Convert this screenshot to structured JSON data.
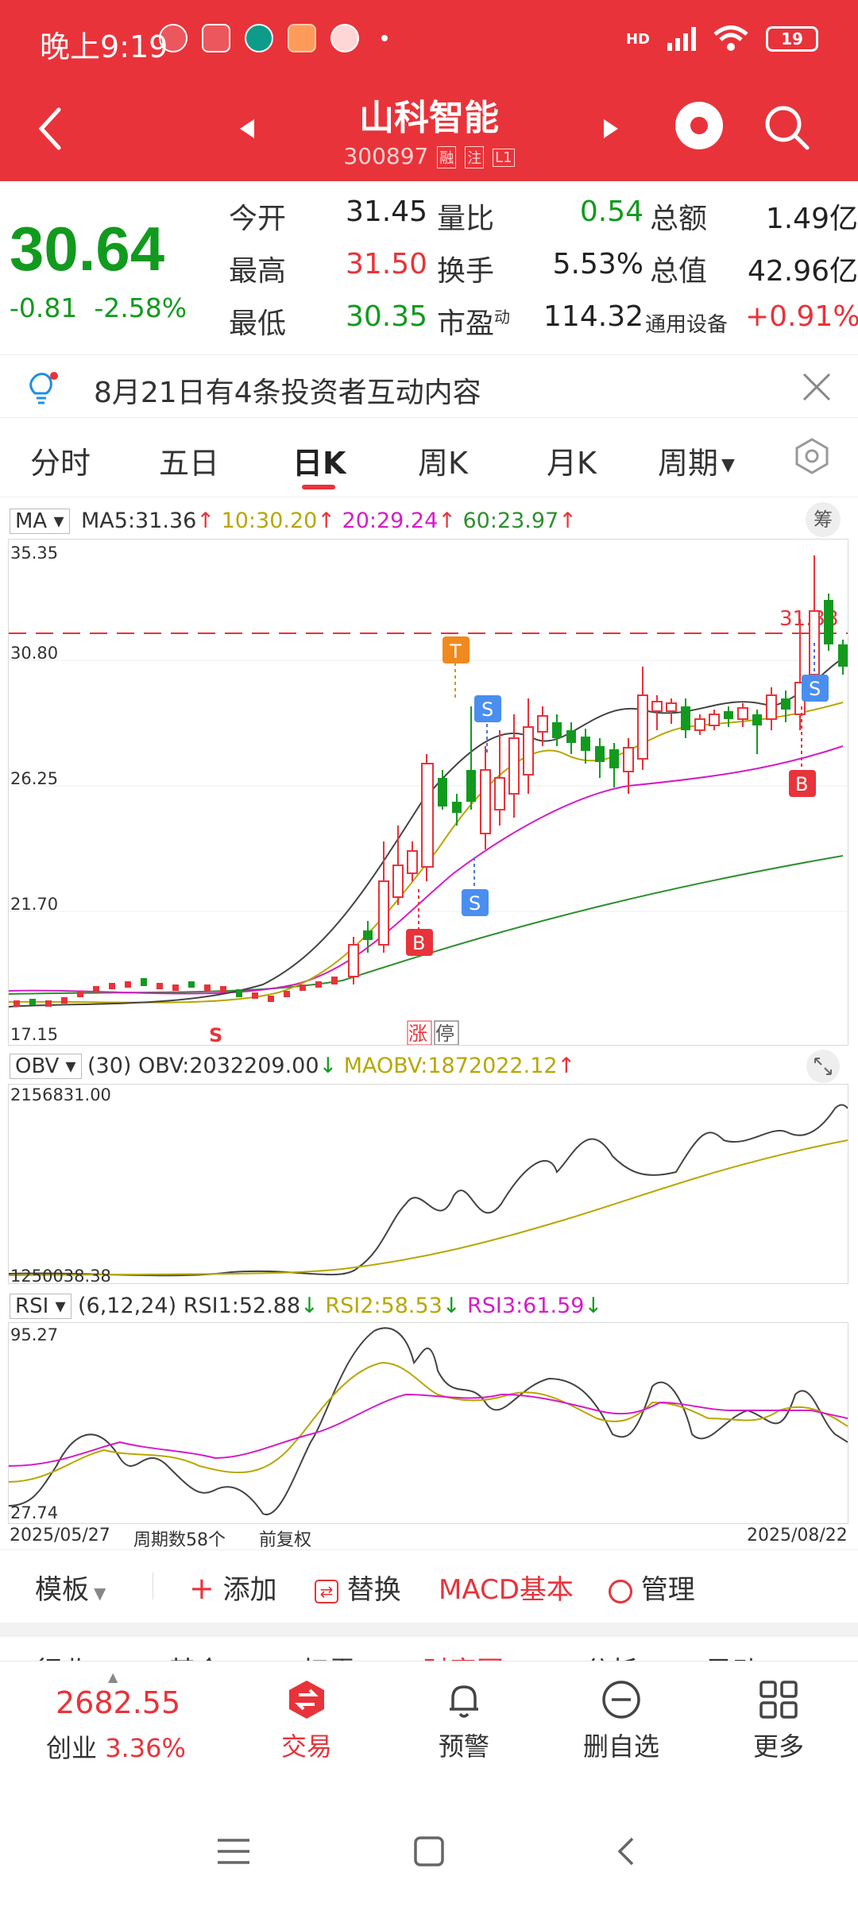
{
  "status_bar": {
    "time": "晚上9:19",
    "battery": "19",
    "network": "HD"
  },
  "header": {
    "stock_name": "山科智能",
    "stock_code": "300897",
    "tags": [
      "融",
      "注",
      "L1"
    ]
  },
  "quote": {
    "price": "30.64",
    "change": "-0.81",
    "change_pct": "-2.58%",
    "rows": [
      [
        {
          "label": "今开",
          "value": "31.45",
          "color": "default"
        },
        {
          "label": "量比",
          "value": "0.54",
          "color": "green"
        },
        {
          "label": "总额",
          "value": "1.49亿",
          "color": "default"
        }
      ],
      [
        {
          "label": "最高",
          "value": "31.50",
          "color": "red"
        },
        {
          "label": "换手",
          "value": "5.53%",
          "color": "default"
        },
        {
          "label": "总值",
          "value": "42.96亿",
          "color": "default"
        }
      ],
      [
        {
          "label": "最低",
          "value": "30.35",
          "color": "green"
        },
        {
          "label": "市盈",
          "sup": "动",
          "value": "114.32",
          "color": "default"
        },
        {
          "label": "通用设备",
          "value": "+0.91%",
          "color": "red",
          "label_color": "orange"
        }
      ]
    ]
  },
  "notice": {
    "text": "8月21日有4条投资者互动内容"
  },
  "period_tabs": [
    "分时",
    "五日",
    "日K",
    "周K",
    "月K",
    "周期"
  ],
  "active_tab": "日K",
  "kline": {
    "indicator": "MA",
    "ma": [
      {
        "label": "MA5:",
        "value": "31.36",
        "color": "#333333"
      },
      {
        "label": "10:",
        "value": "30.20",
        "color": "#b7a700"
      },
      {
        "label": "20:",
        "value": "29.24",
        "color": "#d41cc8"
      },
      {
        "label": "60:",
        "value": "23.97",
        "color": "#2f8f2f"
      }
    ],
    "chip_label": "筹",
    "axis": [
      "35.35",
      "30.80",
      "26.25",
      "21.70",
      "17.15"
    ],
    "ref_price_label": "31.38",
    "markers": {
      "T": "T",
      "S": "S",
      "B": "B"
    },
    "bottom_tags": {
      "s": "S",
      "limit_up": "涨",
      "halt": "停"
    }
  },
  "obv": {
    "indicator": "OBV",
    "params": "(30)",
    "obv_label": "OBV:",
    "obv_value": "2032209.00",
    "maobv_label": "MAOBV:",
    "maobv_value": "1872022.12",
    "axis_top": "2156831.00",
    "axis_bottom": "1250038.38"
  },
  "rsi": {
    "indicator": "RSI",
    "params": "(6,12,24)",
    "rsi1_label": "RSI1:",
    "rsi1_value": "52.88",
    "rsi2_label": "RSI2:",
    "rsi2_value": "58.53",
    "rsi3_label": "RSI3:",
    "rsi3_value": "61.59",
    "axis_top": "95.27",
    "axis_bottom": "27.74"
  },
  "date_axis": {
    "start": "2025/05/27",
    "week_count": "周期数58个",
    "adjust": "前复权",
    "end": "2025/08/22"
  },
  "toolbar": {
    "template": "模板",
    "add": "添加",
    "replace": "替换",
    "macd": "MACD基本",
    "manage": "管理"
  },
  "peek_tabs": [
    "行业",
    "基金",
    "扫雷",
    "财富圈",
    "AI分析",
    "异动"
  ],
  "bottom_nav": {
    "index_value": "2682.55",
    "index_name": "创业",
    "index_change": "3.36%",
    "items": [
      "交易",
      "预警",
      "删自选",
      "更多"
    ]
  },
  "colors": {
    "brand_red": "#e8333a",
    "down_green": "#129a1f",
    "accent_orange": "#e98a1e"
  }
}
